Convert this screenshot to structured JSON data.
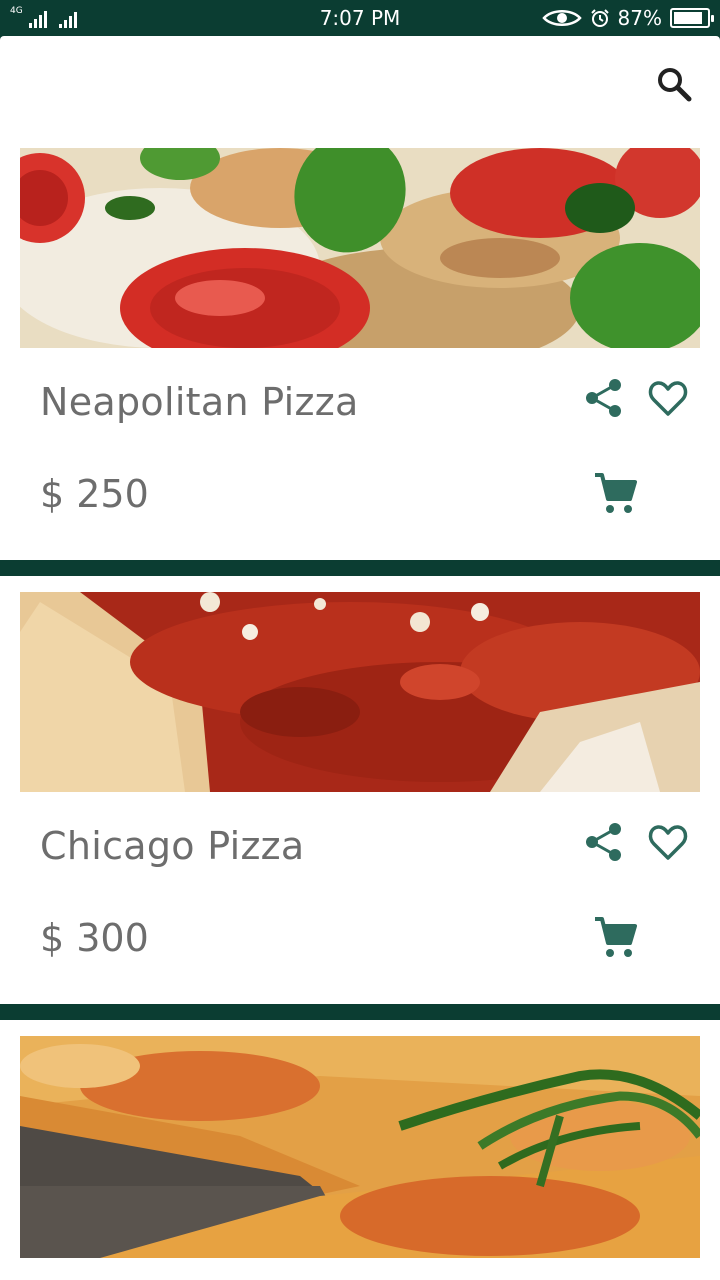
{
  "status_bar": {
    "network": "4G",
    "time": "7:07 PM",
    "battery": "87%",
    "battery_level": 0.87
  },
  "colors": {
    "primary_dark": "#0b3d32",
    "accent": "#2e6b5e",
    "text_secondary": "#6d6d6d"
  },
  "toolbar": {
    "search_icon": "search-icon"
  },
  "products": [
    {
      "name": "Neapolitan Pizza",
      "price": "$ 250",
      "image": "neapolitan-pizza-photo"
    },
    {
      "name": "Chicago Pizza",
      "price": "$ 300",
      "image": "chicago-pizza-photo"
    },
    {
      "name": "",
      "price": "",
      "image": "cheese-pizza-photo"
    }
  ],
  "icons": {
    "share": "share-icon",
    "favorite": "heart-outline-icon",
    "cart": "shopping-cart-icon"
  }
}
